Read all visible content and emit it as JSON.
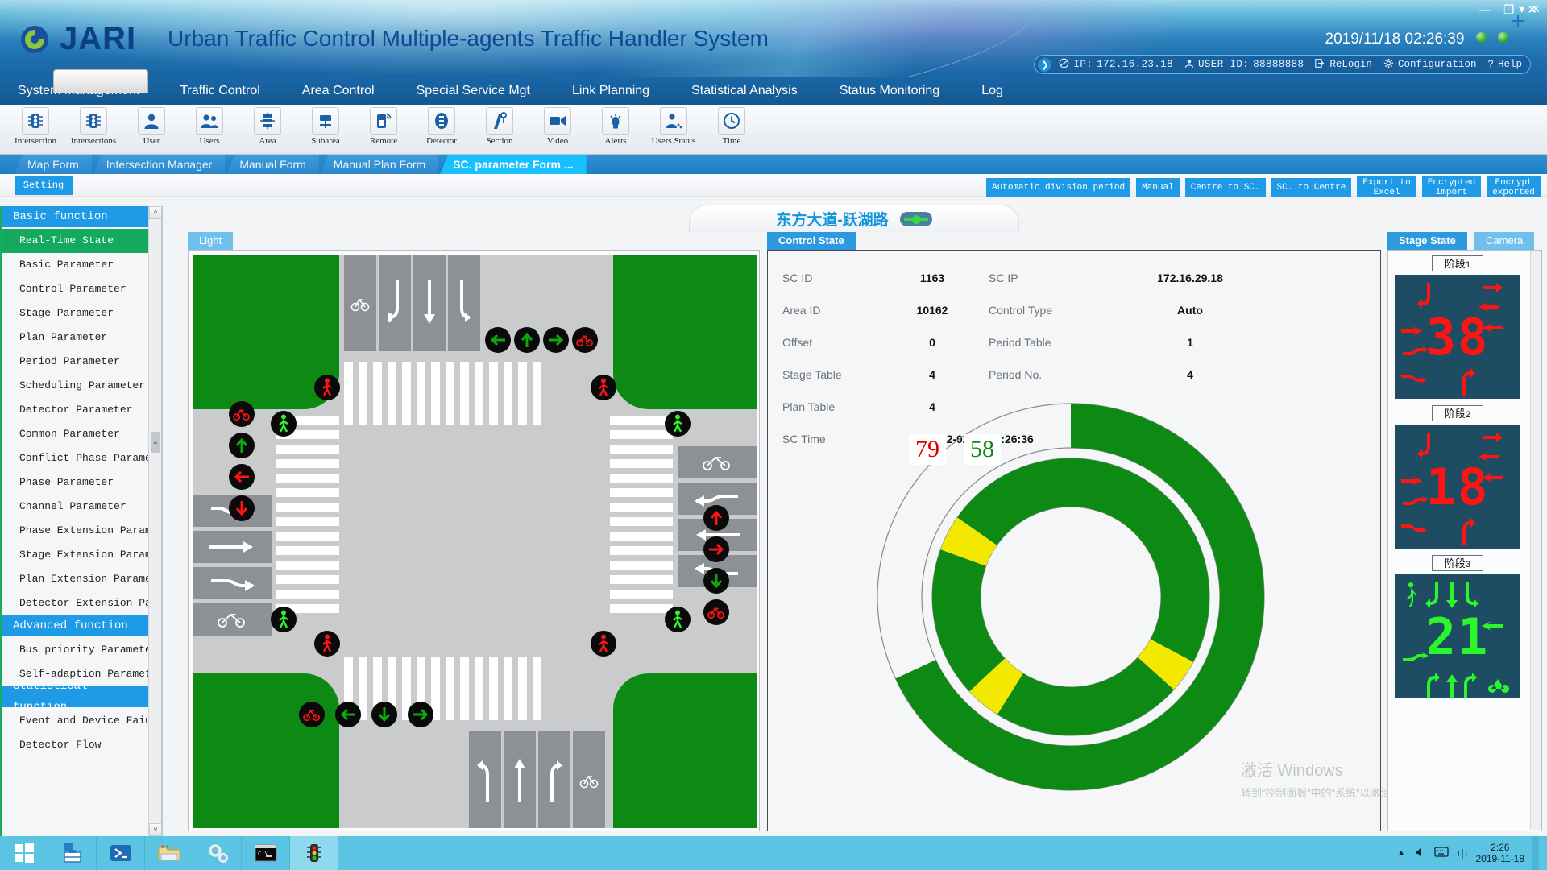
{
  "header": {
    "brand": "JARI",
    "title": "Urban Traffic Control Multiple-agents Traffic Handler System",
    "clock": "2019/11/18 02:26:39",
    "ip_label": "IP:",
    "ip_value": "172.16.23.18",
    "user_label": "USER ID:",
    "user_value": "88888888",
    "relogin": "ReLogin",
    "configuration": "Configuration",
    "help": "Help",
    "win_minimize": "—",
    "win_maximize": "❐",
    "win_close": "✕"
  },
  "menubar": {
    "items": [
      {
        "label": "System Management",
        "active": true
      },
      {
        "label": "Traffic Control",
        "active": false
      },
      {
        "label": "Area Control",
        "active": false
      },
      {
        "label": "Special Service Mgt",
        "active": false
      },
      {
        "label": "Link Planning",
        "active": false
      },
      {
        "label": "Statistical Analysis",
        "active": false
      },
      {
        "label": "Status Monitoring",
        "active": false
      },
      {
        "label": "Log",
        "active": false
      }
    ]
  },
  "toolbar": {
    "items": [
      {
        "label": "Intersection",
        "icon": "traffic-light-icon"
      },
      {
        "label": "Intersections",
        "icon": "traffic-lights-icon"
      },
      {
        "label": "User",
        "icon": "user-icon"
      },
      {
        "label": "Users",
        "icon": "users-icon"
      },
      {
        "label": "Area",
        "icon": "area-icon"
      },
      {
        "label": "Subarea",
        "icon": "subarea-icon"
      },
      {
        "label": "Remote",
        "icon": "remote-icon"
      },
      {
        "label": "Detector",
        "icon": "detector-icon"
      },
      {
        "label": "Section",
        "icon": "section-icon"
      },
      {
        "label": "Video",
        "icon": "video-icon"
      },
      {
        "label": "Alerts",
        "icon": "alerts-icon"
      },
      {
        "label": "Users Status",
        "icon": "users-status-icon"
      },
      {
        "label": "Time",
        "icon": "clock-icon"
      }
    ],
    "add_label": "+"
  },
  "form_tabs": {
    "tabs": [
      {
        "label": "Map  Form",
        "selected": false
      },
      {
        "label": "Intersection Manager",
        "selected": false
      },
      {
        "label": "Manual Form",
        "selected": false
      },
      {
        "label": "Manual Plan  Form",
        "selected": false
      },
      {
        "label": "SC. parameter Form    ...",
        "selected": true
      }
    ],
    "collapse": "▾",
    "close": "✕"
  },
  "setting_strip": {
    "setting_label": "Setting",
    "actions": [
      "Automatic division period",
      "Manual",
      "Centre to SC.",
      "SC. to Centre",
      "Export to\nExcel",
      "Encrypted\nimport",
      "Encrypt\nexported"
    ]
  },
  "sidebar": {
    "groups": [
      {
        "title": "Basic function",
        "items": [
          {
            "label": "Real-Time State",
            "selected": true
          },
          {
            "label": "Basic Parameter",
            "selected": false
          },
          {
            "label": "Control Parameter",
            "selected": false
          },
          {
            "label": "Stage Parameter",
            "selected": false
          },
          {
            "label": "Plan Parameter",
            "selected": false
          },
          {
            "label": "Period Parameter",
            "selected": false
          },
          {
            "label": "Scheduling Parameter",
            "selected": false
          },
          {
            "label": "Detector Parameter",
            "selected": false
          },
          {
            "label": "Common Parameter",
            "selected": false
          },
          {
            "label": "Conflict Phase Parameter",
            "selected": false
          },
          {
            "label": "Phase Parameter",
            "selected": false
          },
          {
            "label": "Channel Parameter",
            "selected": false
          },
          {
            "label": "Phase Extension Parameter",
            "selected": false
          },
          {
            "label": "Stage Extension Parameter",
            "selected": false
          },
          {
            "label": "Plan Extension Parameter",
            "selected": false
          },
          {
            "label": "Detector Extension Parameter",
            "selected": false
          }
        ]
      },
      {
        "title": "Advanced function",
        "items": [
          {
            "label": "Bus priority Parameter",
            "selected": false
          },
          {
            "label": "Self-adaption Parameter",
            "selected": false
          }
        ]
      },
      {
        "title": "Statistical function",
        "items": [
          {
            "label": "Event and Device Faiure",
            "selected": false
          },
          {
            "label": "Detector Flow",
            "selected": false
          }
        ]
      }
    ]
  },
  "intersection": {
    "name": "东方大道-跃湖路",
    "light_tab": "Light",
    "online": true
  },
  "control_state": {
    "tab": "Control State",
    "rows": [
      {
        "label": "SC ID",
        "value": "1163",
        "label2": "SC IP",
        "value2": "172.16.29.18"
      },
      {
        "label": "Area ID",
        "value": "10162",
        "label2": "Control Type",
        "value2": "Auto"
      },
      {
        "label": "Offset",
        "value": "0",
        "label2": "Period Table",
        "value2": "1"
      },
      {
        "label": "Stage Table",
        "value": "4",
        "label2": "Period No.",
        "value2": "4"
      },
      {
        "label": "Plan Table",
        "value": "4",
        "label2": "",
        "value2": ""
      },
      {
        "label": "SC Time",
        "value": "2022-02-16 16:26:36",
        "label2": "",
        "value2": ""
      }
    ]
  },
  "chart_data": {
    "type": "pie",
    "title": "Cycle phase ring gauge",
    "center_labels": {
      "elapsed": "79",
      "remaining": "58"
    },
    "rings": [
      {
        "name": "outer-cycle",
        "radius_hint": "outer",
        "segments": [
          {
            "label": "green",
            "color": "#0c8a14",
            "start_deg": 0,
            "end_deg": 245
          },
          {
            "label": "empty",
            "color": "#f4f6f7",
            "start_deg": 245,
            "end_deg": 360
          }
        ]
      },
      {
        "name": "inner-stages",
        "radius_hint": "inner",
        "segments": [
          {
            "label": "green",
            "color": "#0c8a14",
            "start_deg": 0,
            "end_deg": 118
          },
          {
            "label": "yellow",
            "color": "#f2e800",
            "start_deg": 118,
            "end_deg": 132
          },
          {
            "label": "green",
            "color": "#0c8a14",
            "start_deg": 132,
            "end_deg": 212
          },
          {
            "label": "yellow",
            "color": "#f2e800",
            "start_deg": 212,
            "end_deg": 227
          },
          {
            "label": "green",
            "color": "#0c8a14",
            "start_deg": 227,
            "end_deg": 290
          },
          {
            "label": "yellow",
            "color": "#f2e800",
            "start_deg": 290,
            "end_deg": 305
          },
          {
            "label": "green",
            "color": "#0c8a14",
            "start_deg": 305,
            "end_deg": 360
          }
        ]
      }
    ],
    "grid": false,
    "legend": "none"
  },
  "watermark": {
    "line1": "激活 Windows",
    "line2": "转到“控制面板”中的“系统”以激活 Windows。"
  },
  "stage_panel": {
    "tabs": [
      {
        "label": "Stage State",
        "selected": true
      },
      {
        "label": "Camera",
        "selected": false
      }
    ],
    "stages": [
      {
        "caption": "阶段",
        "index": "1",
        "countdown": "38",
        "color": "red"
      },
      {
        "caption": "阶段",
        "index": "2",
        "countdown": "18",
        "color": "red"
      },
      {
        "caption": "阶段",
        "index": "3",
        "countdown": "21",
        "color": "green"
      }
    ]
  },
  "taskbar": {
    "items": [
      {
        "icon": "windows-start-icon",
        "active": false
      },
      {
        "icon": "toolbox-icon",
        "active": false
      },
      {
        "icon": "powershell-icon",
        "active": false
      },
      {
        "icon": "folder-icon",
        "active": false
      },
      {
        "icon": "settings-gears-icon",
        "active": false
      },
      {
        "icon": "cmd-icon",
        "active": false
      },
      {
        "icon": "traffic-app-icon",
        "active": true
      }
    ],
    "tray_time": "2:26",
    "tray_date": "2019-11-18",
    "tray_icons": [
      "up-chevron-icon",
      "volume-icon",
      "keyboard-icon",
      "ime-icon"
    ]
  },
  "colors": {
    "brand_blue": "#0d4a95",
    "accent_blue": "#1e9ae6",
    "selected_green": "#13a95f",
    "signal_green": "#0c8a14",
    "signal_red": "#e00000",
    "signal_yellow": "#f2e800"
  }
}
